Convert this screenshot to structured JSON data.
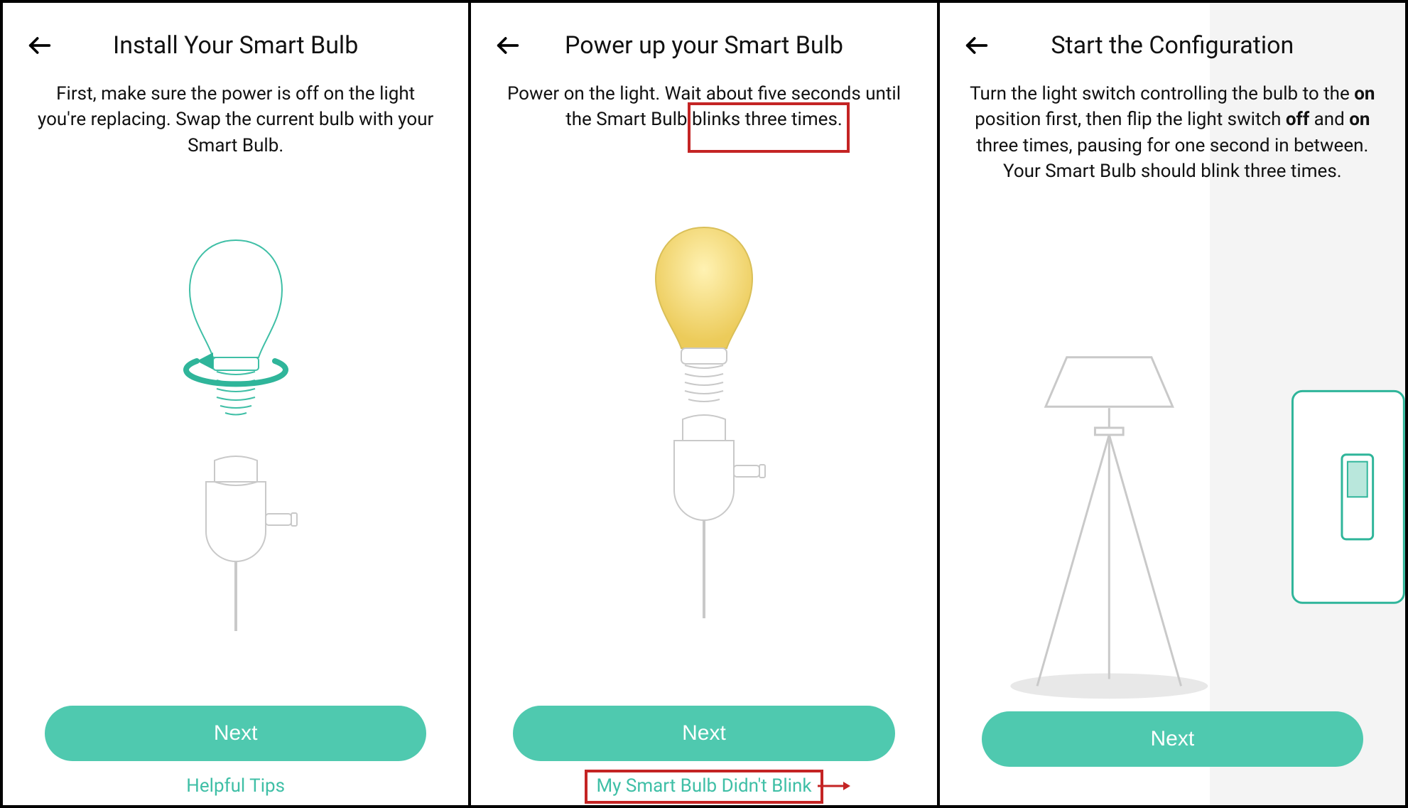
{
  "colors": {
    "accent": "#4fc9af",
    "highlight": "#c42424",
    "bulb_glow": "#f4d97a"
  },
  "panel1": {
    "title": "Install Your Smart Bulb",
    "desc": "First, make sure the power is off on the light you're replacing. Swap the current bulb with your Smart Bulb.",
    "next": "Next",
    "link": "Helpful Tips"
  },
  "panel2": {
    "title": "Power up your Smart Bulb",
    "desc_before": "Power on the light. Wait about five seconds until the Smart Bulb ",
    "desc_highlight": "blinks three times.",
    "next": "Next",
    "link": "My Smart Bulb Didn't Blink"
  },
  "panel3": {
    "title": "Start the Configuration",
    "desc_parts": {
      "p1": "Turn the light switch controlling the bulb to the ",
      "b1": "on",
      "p2": " position first, then flip the light switch ",
      "b2": "off",
      "p3": " and ",
      "b3": "on",
      "p4": " three times, pausing for one second in between. Your Smart Bulb should blink three times."
    },
    "next": "Next"
  }
}
